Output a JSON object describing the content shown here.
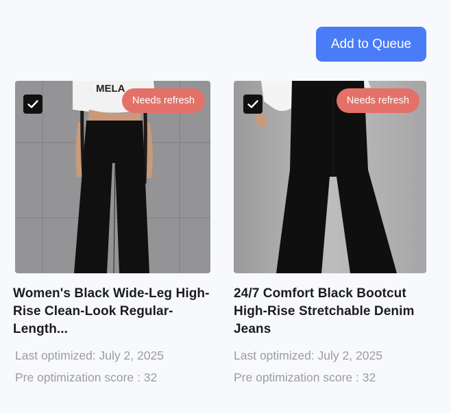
{
  "toolbar": {
    "add_to_queue_label": "Add to Queue"
  },
  "products": [
    {
      "title": "Women's Black Wide-Leg High-Rise Clean-Look Regular-Length...",
      "badge": "Needs refresh",
      "checked": true,
      "last_optimized": "Last optimized: July 2, 2025",
      "pre_score": "Pre optimization score : 32"
    },
    {
      "title": "24/7 Comfort Black Bootcut High-Rise Stretchable Denim Jeans",
      "badge": "Needs refresh",
      "checked": true,
      "last_optimized": "Last optimized: July 2, 2025",
      "pre_score": "Pre optimization score : 32"
    }
  ],
  "photos": [
    {
      "shirt_text": "MELA"
    }
  ],
  "colors": {
    "accent": "#4a7cf7",
    "badge": "#e37169",
    "checkbox": "#111111",
    "muted_text": "#9b9ba2",
    "title_text": "#1b1b24",
    "background": "#f8f9fc"
  }
}
